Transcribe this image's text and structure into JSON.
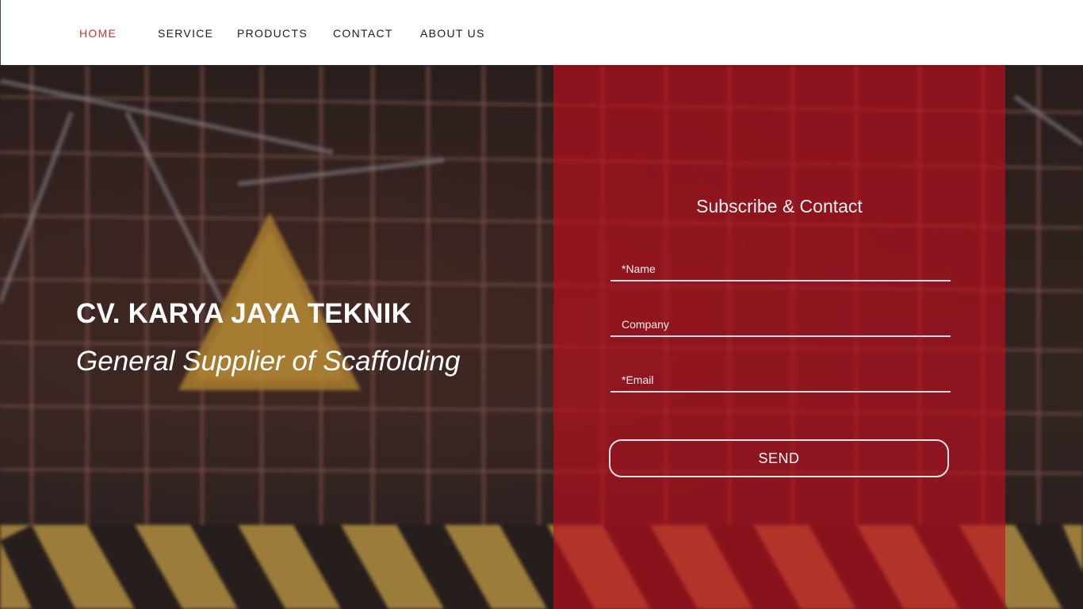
{
  "nav": {
    "items": [
      {
        "label": "HOME",
        "active": true
      },
      {
        "label": "SERVICE",
        "active": false
      },
      {
        "label": "PRODUCTS",
        "active": false
      },
      {
        "label": "CONTACT",
        "active": false
      },
      {
        "label": "ABOUT US",
        "active": false
      }
    ]
  },
  "hero": {
    "title": "CV. KARYA JAYA TEKNIK",
    "tagline": "General Supplier of Scaffolding"
  },
  "contact_form": {
    "title": "Subscribe & Contact",
    "name_placeholder": "*Name",
    "company_placeholder": "Company",
    "email_placeholder": "*Email",
    "name_value": "",
    "company_value": "",
    "email_value": "",
    "send_label": "SEND"
  },
  "colors": {
    "accent_red": "#d0342c",
    "panel_red": "#be0e1e",
    "nav_bg": "#ffffff"
  }
}
